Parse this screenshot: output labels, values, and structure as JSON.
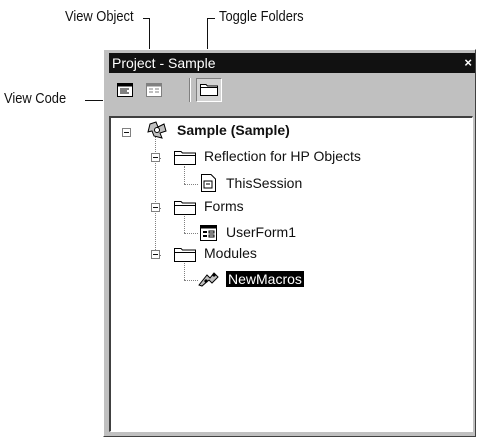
{
  "callouts": {
    "view_object": "View Object",
    "toggle_folders": "Toggle Folders",
    "view_code": "View Code"
  },
  "window": {
    "title": "Project - Sample",
    "close_glyph": "×"
  },
  "toolbar": {
    "buttons": [
      {
        "name": "view-code",
        "icon": "view-code-icon"
      },
      {
        "name": "view-object",
        "icon": "view-object-icon"
      },
      {
        "name": "toggle-folders",
        "icon": "folder-icon"
      }
    ]
  },
  "tree": {
    "root": {
      "label": "Sample (Sample)",
      "icon": "vba-project-icon"
    },
    "folders": [
      {
        "label": "Reflection for HP Objects",
        "icon": "folder-icon",
        "children": [
          {
            "label": "ThisSession",
            "icon": "document-module-icon"
          }
        ]
      },
      {
        "label": "Forms",
        "icon": "folder-icon",
        "children": [
          {
            "label": "UserForm1",
            "icon": "userform-icon"
          }
        ]
      },
      {
        "label": "Modules",
        "icon": "folder-icon",
        "children": [
          {
            "label": "NewMacros",
            "icon": "module-icon",
            "selected": true
          }
        ]
      }
    ]
  }
}
